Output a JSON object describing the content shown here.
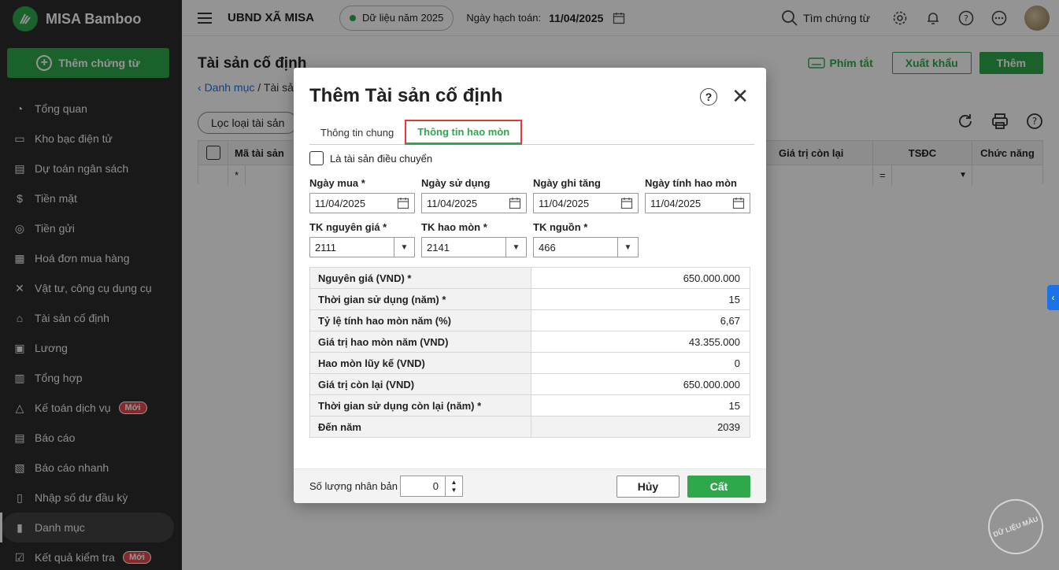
{
  "sidebar": {
    "brand": "MISA Bamboo",
    "add_button": "Thêm chứng từ",
    "items": [
      {
        "label": "Tổng quan",
        "icon": "pie-chart-icon"
      },
      {
        "label": "Kho bạc điện tử",
        "icon": "monitor-icon"
      },
      {
        "label": "Dự toán ngân sách",
        "icon": "budget-icon"
      },
      {
        "label": "Tiền mặt",
        "icon": "cash-icon"
      },
      {
        "label": "Tiền gửi",
        "icon": "deposit-icon"
      },
      {
        "label": "Hoá đơn mua hàng",
        "icon": "invoice-icon"
      },
      {
        "label": "Vật tư, công cụ dụng cụ",
        "icon": "tools-icon"
      },
      {
        "label": "Tài sản cố định",
        "icon": "building-icon"
      },
      {
        "label": "Lương",
        "icon": "salary-icon"
      },
      {
        "label": "Tổng hợp",
        "icon": "summary-icon"
      },
      {
        "label": "Kế toán dịch vụ",
        "icon": "service-icon",
        "badge": "Mới"
      },
      {
        "label": "Báo cáo",
        "icon": "report-icon"
      },
      {
        "label": "Báo cáo nhanh",
        "icon": "quick-report-icon"
      },
      {
        "label": "Nhập số dư đầu kỳ",
        "icon": "import-icon"
      },
      {
        "label": "Danh mục",
        "icon": "catalog-icon",
        "active": true
      },
      {
        "label": "Kết quả kiểm tra",
        "icon": "check-result-icon",
        "badge": "Mới"
      }
    ]
  },
  "topbar": {
    "org": "UBND XÃ MISA",
    "year": "Dữ liệu năm 2025",
    "date_label": "Ngày hạch toán:",
    "date_value": "11/04/2025",
    "search": "Tìm chứng từ"
  },
  "page": {
    "title": "Tài sản cố định",
    "shortcut": "Phím tắt",
    "export": "Xuất khẩu",
    "add": "Thêm",
    "breadcrumb_link": "Danh mục",
    "breadcrumb_current": " / Tài sản",
    "filter": "Lọc loại tài sản",
    "grid": {
      "col_code": "Mã tài sản",
      "col_remaining": "Giá trị còn lại",
      "col_tsdc": "TSĐC",
      "col_actions": "Chức năng",
      "filter_star": "*",
      "filter_eq": "="
    }
  },
  "modal": {
    "title": "Thêm Tài sản cố định",
    "tabs": [
      "Thông tin chung",
      "Thông tin hao mòn"
    ],
    "transfer_checkbox": "Là tài sản điều chuyển",
    "fields": {
      "buy_date_label": "Ngày mua *",
      "buy_date": "11/04/2025",
      "use_date_label": "Ngày sử dụng",
      "use_date": "11/04/2025",
      "record_date_label": "Ngày ghi tăng",
      "record_date": "11/04/2025",
      "dep_date_label": "Ngày tính hao mòn",
      "dep_date": "11/04/2025",
      "acc_cost_label": "TK nguyên giá *",
      "acc_cost": "2111",
      "acc_dep_label": "TK hao mòn *",
      "acc_dep": "2141",
      "acc_source_label": "TK nguồn *",
      "acc_source": "466"
    },
    "table": [
      {
        "label": "Nguyên giá (VND) *",
        "value": "650.000.000",
        "readonly": false
      },
      {
        "label": "Thời gian sử dụng (năm) *",
        "value": "15",
        "readonly": false
      },
      {
        "label": "Tỷ lệ tính hao mòn năm (%)",
        "value": "6,67",
        "readonly": false
      },
      {
        "label": "Giá trị hao mòn năm (VND)",
        "value": "43.355.000",
        "readonly": false
      },
      {
        "label": "Hao mòn lũy kế (VND)",
        "value": "0",
        "readonly": false
      },
      {
        "label": "Giá trị còn lại (VND)",
        "value": "650.000.000",
        "readonly": false
      },
      {
        "label": "Thời gian sử dụng còn lại (năm) *",
        "value": "15",
        "readonly": false
      },
      {
        "label": "Đến năm",
        "value": "2039",
        "readonly": true
      }
    ],
    "footer": {
      "dup_label": "Số lượng nhân bản",
      "dup_value": "0",
      "cancel": "Hủy",
      "save": "Cất"
    }
  },
  "stamp": "DỮ LIỆU MẪU",
  "colors": {
    "accent": "#2ea84a",
    "sidebar": "#2b2b2b",
    "link": "#1a73e8",
    "highlight": "#e53935"
  }
}
